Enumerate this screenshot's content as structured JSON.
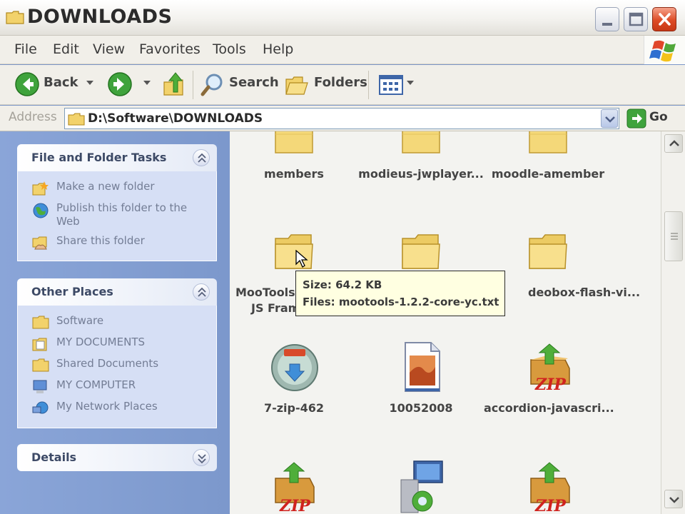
{
  "window": {
    "title": "DOWNLOADS"
  },
  "menu": {
    "file": "File",
    "edit": "Edit",
    "view": "View",
    "favorites": "Favorites",
    "tools": "Tools",
    "help": "Help"
  },
  "toolbar": {
    "back": "Back",
    "search": "Search",
    "folders": "Folders"
  },
  "address": {
    "label": "Address",
    "value": "D:\\Software\\DOWNLOADS",
    "go": "Go"
  },
  "tasks_panel": {
    "title": "File and Folder Tasks",
    "items": [
      {
        "label": "Make a new folder",
        "icon": "new-folder-icon"
      },
      {
        "label": "Publish this folder to the",
        "label2": "Web",
        "icon": "publish-web-icon"
      },
      {
        "label": "Share this folder",
        "icon": "share-folder-icon"
      }
    ]
  },
  "places_panel": {
    "title": "Other Places",
    "items": [
      {
        "label": "Software",
        "icon": "folder-icon"
      },
      {
        "label": "MY DOCUMENTS",
        "icon": "my-documents-icon"
      },
      {
        "label": "Shared Documents",
        "icon": "folder-icon"
      },
      {
        "label": "MY COMPUTER",
        "icon": "my-computer-icon"
      },
      {
        "label": "My Network Places",
        "icon": "network-places-icon"
      }
    ]
  },
  "details_panel": {
    "title": "Details"
  },
  "files": {
    "row1": [
      "members",
      "modieus-jwplayer...",
      "moodle-amember"
    ],
    "row2": [
      {
        "line1": "MooTools",
        "line2": "JS Fram"
      },
      {
        "line1": "",
        "line2": ""
      },
      {
        "line1": "deobox-flash-vi...",
        "line2": ""
      }
    ],
    "row3": [
      "7-zip-462",
      "10052008",
      "accordion-javascri..."
    ]
  },
  "tooltip": {
    "size": "Size: 64.2 KB",
    "files": "Files: mootools-1.2.2-core-yc.txt"
  },
  "colors": {
    "task_pane": "#7c98cc",
    "panel_body": "#d6dff5",
    "tooltip_bg": "#ffffe1",
    "close_button": "#dd4b25"
  }
}
